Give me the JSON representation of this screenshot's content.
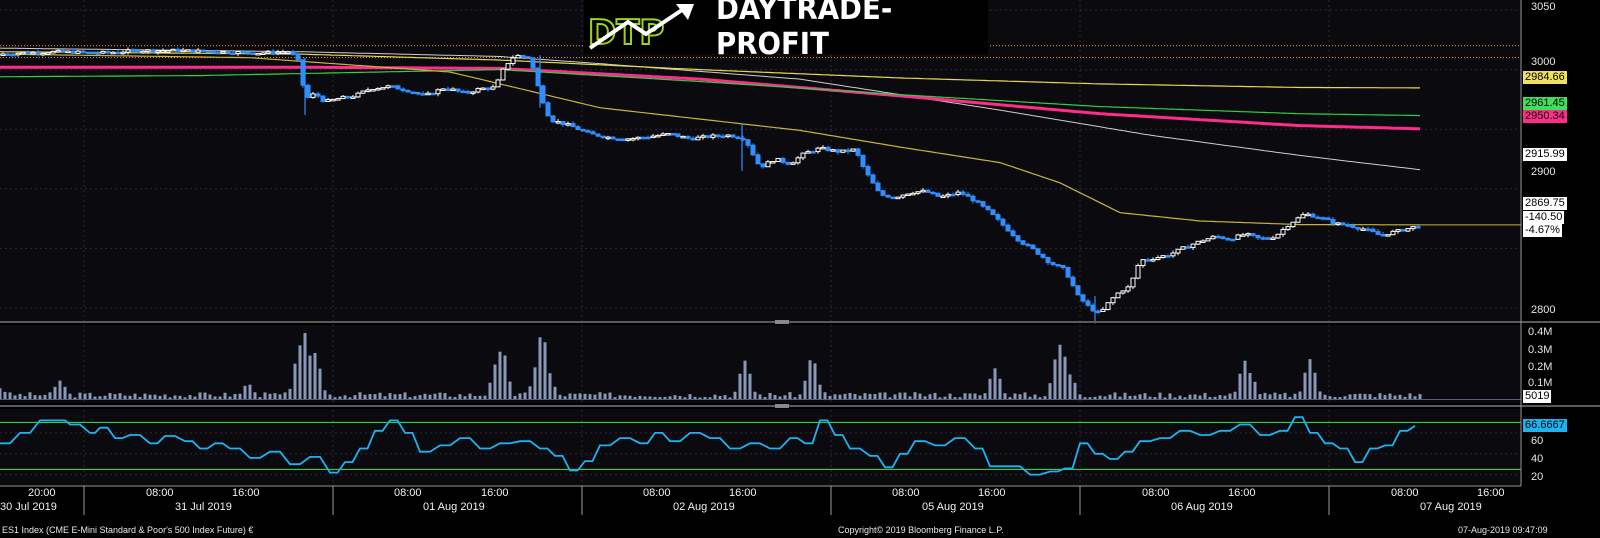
{
  "brand": {
    "logo_letters": "DTP",
    "name": "DAYTRADE-PROFIT"
  },
  "footer": {
    "instrument": "ES1 Index (CME E-Mini Standard & Poor's 500 Index Future) €",
    "copyright": "Copyright© 2019 Bloomberg Finance L.P.",
    "timestamp": "07-Aug-2019 09:47:09"
  },
  "time_axis": {
    "hour_ticks": [
      "20:00",
      "08:00",
      "16:00",
      "08:00",
      "16:00",
      "08:00",
      "16:00",
      "08:00",
      "16:00",
      "08:00",
      "16:00",
      "08:00",
      "16:00"
    ],
    "date_labels": [
      "30 Jul 2019",
      "31 Jul 2019",
      "01 Aug 2019",
      "02 Aug 2019",
      "05 Aug 2019",
      "06 Aug 2019",
      "07 Aug 2019"
    ]
  },
  "price_panel": {
    "y_ticks": [
      "3050",
      "3000",
      "2950",
      "2900",
      "2850",
      "2800"
    ],
    "ma_tags": {
      "ma_yellow": "2984.66",
      "ma_green": "2961.45",
      "ma_magenta": "2950.34",
      "ma_white": "2915.99"
    },
    "last_price": "2869.75",
    "change": "-140.50",
    "change_pct": "-4.67%"
  },
  "volume_panel": {
    "y_ticks": [
      "0.4M",
      "0.3M",
      "0.2M",
      "0.1M"
    ],
    "last_value": "5019"
  },
  "rsi_panel": {
    "y_ticks": [
      "60",
      "40",
      "20"
    ],
    "last_value": "66.6667"
  },
  "colors": {
    "candle_up": "#ffffff",
    "candle_down": "#2f8fff",
    "ma_yellow": "#e7d84a",
    "ma_green": "#2ed04a",
    "ma_magenta": "#ff2d8a",
    "ma_white": "#cfcfcf",
    "ma_fast": "#c8b43a",
    "dotted_ref": "#ff9a3a",
    "rsi_line": "#1fb2f0",
    "volume_bar": "#8a98b8"
  },
  "chart_data": {
    "type": "candlestick",
    "title": "",
    "price_range": [
      2762,
      3058
    ],
    "reference_levels": [
      3020,
      3010
    ],
    "price_path": [
      [
        0,
        3013
      ],
      [
        20,
        3014
      ],
      [
        60,
        3015
      ],
      [
        100,
        3014
      ],
      [
        140,
        3016
      ],
      [
        180,
        3016
      ],
      [
        220,
        3015
      ],
      [
        260,
        3014
      ],
      [
        290,
        3015
      ],
      [
        300,
        3005
      ],
      [
        305,
        2975
      ],
      [
        315,
        2980
      ],
      [
        325,
        2973
      ],
      [
        340,
        2976
      ],
      [
        355,
        2978
      ],
      [
        370,
        2984
      ],
      [
        390,
        2986
      ],
      [
        410,
        2982
      ],
      [
        425,
        2978
      ],
      [
        445,
        2985
      ],
      [
        465,
        2980
      ],
      [
        480,
        2984
      ],
      [
        495,
        2985
      ],
      [
        505,
        3003
      ],
      [
        515,
        3012
      ],
      [
        530,
        3010
      ],
      [
        540,
        2980
      ],
      [
        550,
        2958
      ],
      [
        570,
        2953
      ],
      [
        590,
        2946
      ],
      [
        610,
        2943
      ],
      [
        630,
        2942
      ],
      [
        650,
        2944
      ],
      [
        670,
        2946
      ],
      [
        690,
        2942
      ],
      [
        710,
        2944
      ],
      [
        730,
        2945
      ],
      [
        745,
        2942
      ],
      [
        760,
        2918
      ],
      [
        775,
        2925
      ],
      [
        790,
        2921
      ],
      [
        805,
        2930
      ],
      [
        820,
        2934
      ],
      [
        840,
        2931
      ],
      [
        855,
        2933
      ],
      [
        865,
        2915
      ],
      [
        880,
        2895
      ],
      [
        895,
        2893
      ],
      [
        910,
        2897
      ],
      [
        925,
        2898
      ],
      [
        940,
        2893
      ],
      [
        960,
        2897
      ],
      [
        975,
        2890
      ],
      [
        990,
        2880
      ],
      [
        1005,
        2868
      ],
      [
        1020,
        2856
      ],
      [
        1035,
        2848
      ],
      [
        1050,
        2838
      ],
      [
        1065,
        2832
      ],
      [
        1078,
        2810
      ],
      [
        1090,
        2800
      ],
      [
        1100,
        2795
      ],
      [
        1110,
        2806
      ],
      [
        1120,
        2814
      ],
      [
        1130,
        2818
      ],
      [
        1140,
        2840
      ],
      [
        1155,
        2842
      ],
      [
        1170,
        2845
      ],
      [
        1185,
        2851
      ],
      [
        1200,
        2856
      ],
      [
        1215,
        2860
      ],
      [
        1230,
        2858
      ],
      [
        1245,
        2862
      ],
      [
        1260,
        2858
      ],
      [
        1275,
        2860
      ],
      [
        1290,
        2871
      ],
      [
        1305,
        2879
      ],
      [
        1320,
        2876
      ],
      [
        1335,
        2871
      ],
      [
        1350,
        2869
      ],
      [
        1365,
        2866
      ],
      [
        1380,
        2861
      ],
      [
        1395,
        2864
      ],
      [
        1410,
        2867
      ],
      [
        1420,
        2869.75
      ]
    ],
    "moving_averages": {
      "ma_white": [
        [
          0,
          3018
        ],
        [
          300,
          3015
        ],
        [
          500,
          3011
        ],
        [
          600,
          3005
        ],
        [
          800,
          2992
        ],
        [
          1000,
          2966
        ],
        [
          1150,
          2945
        ],
        [
          1300,
          2928
        ],
        [
          1420,
          2915.99
        ]
      ],
      "ma_magenta": [
        [
          0,
          3002
        ],
        [
          300,
          3002
        ],
        [
          500,
          3001
        ],
        [
          700,
          2992
        ],
        [
          900,
          2978
        ],
        [
          1100,
          2963
        ],
        [
          1300,
          2953
        ],
        [
          1420,
          2950.34
        ]
      ],
      "ma_green": [
        [
          0,
          2994
        ],
        [
          200,
          2995
        ],
        [
          500,
          3000
        ],
        [
          700,
          2990
        ],
        [
          900,
          2979
        ],
        [
          1100,
          2969
        ],
        [
          1300,
          2963
        ],
        [
          1420,
          2961.45
        ]
      ],
      "ma_yellow": [
        [
          0,
          3015
        ],
        [
          300,
          3013
        ],
        [
          500,
          3008
        ],
        [
          700,
          3000
        ],
        [
          900,
          2993
        ],
        [
          1100,
          2988
        ],
        [
          1300,
          2985
        ],
        [
          1420,
          2984.66
        ]
      ],
      "ma_fast": [
        [
          0,
          3013
        ],
        [
          250,
          3010
        ],
        [
          450,
          2998
        ],
        [
          600,
          2968
        ],
        [
          800,
          2949
        ],
        [
          900,
          2935
        ],
        [
          1000,
          2922
        ],
        [
          1060,
          2905
        ],
        [
          1120,
          2880
        ],
        [
          1200,
          2873
        ],
        [
          1300,
          2870
        ],
        [
          1420,
          2869.75
        ]
      ]
    },
    "volume_max": 0.45,
    "volume_spikes": [
      [
        0,
        0.07
      ],
      [
        5,
        0.03
      ],
      [
        60,
        0.12
      ],
      [
        248,
        0.1
      ],
      [
        300,
        0.35
      ],
      [
        305,
        0.43
      ],
      [
        310,
        0.28
      ],
      [
        315,
        0.3
      ],
      [
        497,
        0.24
      ],
      [
        502,
        0.33
      ],
      [
        538,
        0.24
      ],
      [
        542,
        0.43
      ],
      [
        548,
        0.18
      ],
      [
        745,
        0.25
      ],
      [
        812,
        0.27
      ],
      [
        818,
        0.1
      ],
      [
        995,
        0.2
      ],
      [
        1058,
        0.3
      ],
      [
        1061,
        0.36
      ],
      [
        1070,
        0.16
      ],
      [
        1245,
        0.25
      ],
      [
        1250,
        0.17
      ],
      [
        1310,
        0.26
      ]
    ],
    "rsi_range": [
      12,
      80
    ],
    "rsi_levels": [
      70,
      25
    ],
    "rsi_path": [
      [
        0,
        50
      ],
      [
        20,
        60
      ],
      [
        40,
        72
      ],
      [
        60,
        72
      ],
      [
        70,
        68
      ],
      [
        90,
        60
      ],
      [
        100,
        65
      ],
      [
        115,
        55
      ],
      [
        130,
        58
      ],
      [
        150,
        50
      ],
      [
        165,
        57
      ],
      [
        185,
        52
      ],
      [
        200,
        45
      ],
      [
        215,
        50
      ],
      [
        230,
        45
      ],
      [
        250,
        36
      ],
      [
        270,
        42
      ],
      [
        290,
        30
      ],
      [
        310,
        37
      ],
      [
        330,
        22
      ],
      [
        345,
        32
      ],
      [
        360,
        45
      ],
      [
        375,
        62
      ],
      [
        390,
        72
      ],
      [
        405,
        60
      ],
      [
        420,
        42
      ],
      [
        440,
        48
      ],
      [
        460,
        55
      ],
      [
        480,
        45
      ],
      [
        500,
        50
      ],
      [
        520,
        52
      ],
      [
        540,
        45
      ],
      [
        555,
        38
      ],
      [
        570,
        24
      ],
      [
        585,
        33
      ],
      [
        600,
        48
      ],
      [
        620,
        55
      ],
      [
        640,
        50
      ],
      [
        655,
        60
      ],
      [
        670,
        52
      ],
      [
        690,
        60
      ],
      [
        710,
        55
      ],
      [
        730,
        45
      ],
      [
        750,
        50
      ],
      [
        770,
        45
      ],
      [
        790,
        55
      ],
      [
        805,
        50
      ],
      [
        820,
        72
      ],
      [
        835,
        58
      ],
      [
        850,
        45
      ],
      [
        870,
        38
      ],
      [
        885,
        27
      ],
      [
        900,
        40
      ],
      [
        915,
        52
      ],
      [
        935,
        48
      ],
      [
        955,
        55
      ],
      [
        975,
        45
      ],
      [
        990,
        28
      ],
      [
        1010,
        28
      ],
      [
        1030,
        20
      ],
      [
        1050,
        23
      ],
      [
        1065,
        26
      ],
      [
        1080,
        50
      ],
      [
        1095,
        40
      ],
      [
        1110,
        35
      ],
      [
        1125,
        42
      ],
      [
        1140,
        52
      ],
      [
        1160,
        55
      ],
      [
        1180,
        62
      ],
      [
        1200,
        58
      ],
      [
        1220,
        62
      ],
      [
        1240,
        68
      ],
      [
        1260,
        58
      ],
      [
        1280,
        62
      ],
      [
        1295,
        75
      ],
      [
        1310,
        60
      ],
      [
        1325,
        50
      ],
      [
        1340,
        45
      ],
      [
        1355,
        32
      ],
      [
        1370,
        45
      ],
      [
        1385,
        48
      ],
      [
        1400,
        62
      ],
      [
        1415,
        66.6667
      ]
    ]
  }
}
